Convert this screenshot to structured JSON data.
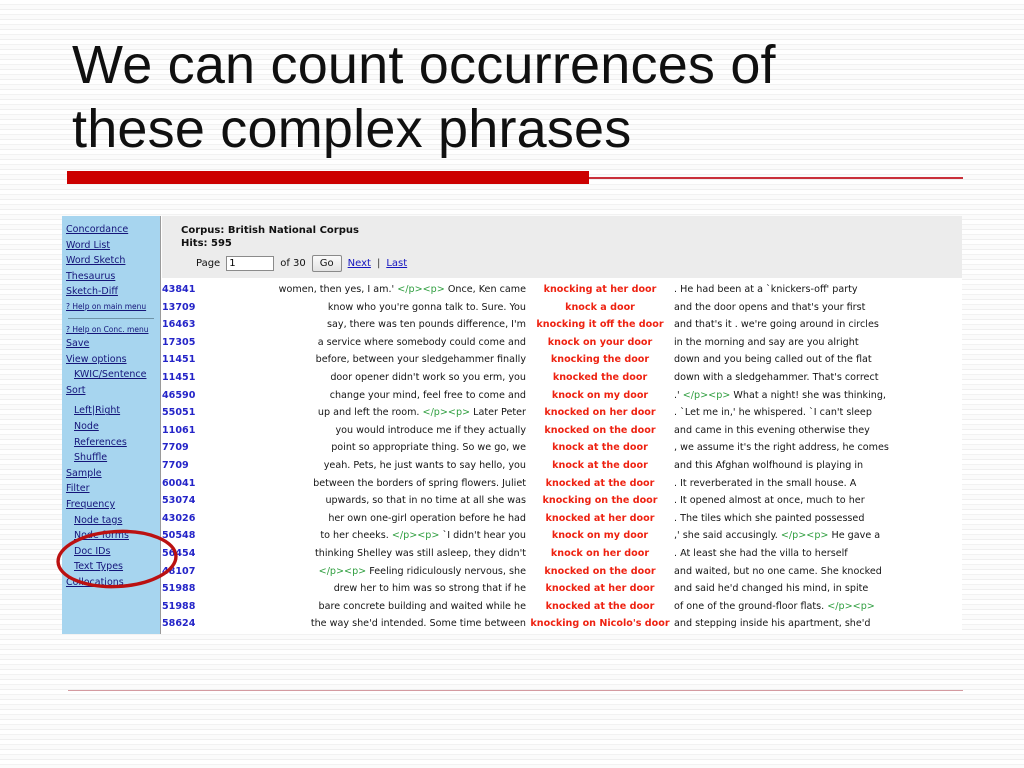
{
  "slide": {
    "title": "We can count occurrences of\nthese complex phrases",
    "accent_color": "#cc0000",
    "rule_color": "#c9303a"
  },
  "app": {
    "sidebar": {
      "background_color": "#a7d5ef",
      "link_color": "#15157a",
      "main_menu": [
        {
          "label": "Concordance"
        },
        {
          "label": "Word List"
        },
        {
          "label": "Word Sketch"
        },
        {
          "label": "Thesaurus"
        },
        {
          "label": "Sketch-Diff"
        }
      ],
      "help_main": "? Help on main menu",
      "help_conc": "? Help on Conc. menu",
      "conc_menu": [
        {
          "label": "Save",
          "indent": false
        },
        {
          "label": "View options",
          "indent": false
        },
        {
          "label": "KWIC/Sentence",
          "indent": true
        },
        {
          "label": "Sort",
          "indent": false
        },
        {
          "label": "Node",
          "indent": true
        },
        {
          "label": "References",
          "indent": true
        },
        {
          "label": "Shuffle",
          "indent": true
        },
        {
          "label": "Sample",
          "indent": false
        },
        {
          "label": "Filter",
          "indent": false
        },
        {
          "label": "Frequency",
          "indent": false
        },
        {
          "label": "Node tags",
          "indent": true
        },
        {
          "label": "Node forms",
          "indent": true
        },
        {
          "label": "Doc IDs",
          "indent": true
        },
        {
          "label": "Text Types",
          "indent": true
        },
        {
          "label": "Collocations",
          "indent": false
        }
      ],
      "sort_left": "Left",
      "sort_sep": "|",
      "sort_right": "Right"
    },
    "header": {
      "corpus_label": "Corpus:",
      "corpus_name": "British National Corpus",
      "hits_label": "Hits:",
      "hits_value": "595",
      "page_label": "Page",
      "page_value": "1",
      "of_label": "of 30",
      "go_label": "Go",
      "next_label": "Next",
      "pipe": "|",
      "last_label": "Last"
    },
    "concordance": {
      "id_color": "#2424c8",
      "kwic_color": "#ee2211",
      "tag_color": "#2f9e3f",
      "rows": [
        {
          "id": "43841",
          "left": "women, then yes, I am.' </p><p> Once, Ken came",
          "kwic": "knocking at her door",
          "right": ". He had been at a `knickers-off' party"
        },
        {
          "id": "13709",
          "left": "know who you're gonna talk to. Sure. You",
          "kwic": "knock a door",
          "right": "and the door opens and that's your first"
        },
        {
          "id": "16463",
          "left": "say, there was ten pounds difference, I'm",
          "kwic": "knocking it off the door",
          "right": "and that's it . we're going around in circles"
        },
        {
          "id": "17305",
          "left": "a service where somebody could come and",
          "kwic": "knock on your door",
          "right": "in the morning and say are you alright"
        },
        {
          "id": "11451",
          "left": "before, between your sledgehammer finally",
          "kwic": "knocking the door",
          "right": "down and you being called out of the flat"
        },
        {
          "id": "11451",
          "left": "door opener didn't work so you erm, you",
          "kwic": "knocked the door",
          "right": "down with a sledgehammer. That's correct"
        },
        {
          "id": "46590",
          "left": "change your mind, feel free to come and",
          "kwic": "knock on my door",
          "right": ".' </p><p> What a night! she was thinking,"
        },
        {
          "id": "55051",
          "left": "up and left the room. </p><p> Later Peter",
          "kwic": "knocked on her door",
          "right": ". `Let me in,' he whispered. `I can't sleep"
        },
        {
          "id": "11061",
          "left": "you would introduce me if they actually",
          "kwic": "knocked on the door",
          "right": "and came in this evening otherwise they"
        },
        {
          "id": "7709",
          "left": "point so appropriate thing. So we go, we",
          "kwic": "knock at the door",
          "right": ", we assume it's the right address, he comes"
        },
        {
          "id": "7709",
          "left": "yeah. Pets, he just wants to say hello, you",
          "kwic": "knock at the door",
          "right": "and this Afghan wolfhound is playing in"
        },
        {
          "id": "60041",
          "left": "between the borders of spring flowers. Juliet",
          "kwic": "knocked at the door",
          "right": ". It reverberated in the small house. A"
        },
        {
          "id": "53074",
          "left": "upwards, so that in no time at all she was",
          "kwic": "knocking on the door",
          "right": ". It opened almost at once, much to her"
        },
        {
          "id": "43026",
          "left": "her own one-girl operation before he had",
          "kwic": "knocked at her door",
          "right": ". The tiles which she painted possessed"
        },
        {
          "id": "50548",
          "left": "to her cheeks. </p><p> `I didn't hear you",
          "kwic": "knock on my door",
          "right": ",' she said accusingly. </p><p> He gave a"
        },
        {
          "id": "56454",
          "left": "thinking Shelley was still asleep, they didn't",
          "kwic": "knock on her door",
          "right": ". At least she had the villa to herself"
        },
        {
          "id": "48107",
          "left": "</p><p> Feeling ridiculously nervous, she",
          "kwic": "knocked on the door",
          "right": "and waited, but no one came. She knocked"
        },
        {
          "id": "51988",
          "left": "drew her to him was so strong that if he",
          "kwic": "knocked at her door",
          "right": "and said he'd changed his mind, in spite"
        },
        {
          "id": "51988",
          "left": "bare concrete building and waited while he",
          "kwic": "knocked at the door",
          "right": "of one of the ground-floor flats. </p><p>"
        },
        {
          "id": "58624",
          "left": "the way she'd intended. Some time between",
          "kwic": "knocking on Nicolo's door",
          "right": "and stepping inside his apartment, she'd"
        }
      ]
    }
  },
  "annotation": {
    "shape": "ellipse",
    "color": "#bb1111",
    "encircles": [
      "Frequency",
      "Node tags",
      "Node forms"
    ]
  }
}
